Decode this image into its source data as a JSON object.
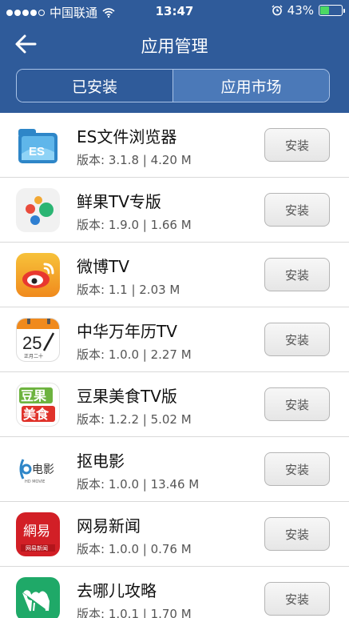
{
  "status_bar": {
    "carrier": "中国联通",
    "time": "13:47",
    "battery_percent": "43%",
    "battery_level": 0.43,
    "signal_filled": 4,
    "signal_total": 5
  },
  "nav": {
    "title": "应用管理"
  },
  "tabs": [
    {
      "label": "已安装",
      "selected": true
    },
    {
      "label": "应用市场",
      "selected": false
    }
  ],
  "colors": {
    "header_bg": "#2f5b9a",
    "tab_inactive_bg": "#4b79b8",
    "battery_fill": "#4cd964"
  },
  "apps": [
    {
      "name": "ES文件浏览器",
      "version_label": "版本: 3.1.8 | 4.20 M",
      "button_label": "安装",
      "icon": "es-file-explorer-icon"
    },
    {
      "name": "鲜果TV专版",
      "version_label": "版本: 1.9.0 | 1.66 M",
      "button_label": "安装",
      "icon": "xianguo-tv-icon"
    },
    {
      "name": "微博TV",
      "version_label": "版本: 1.1 | 2.03 M",
      "button_label": "安装",
      "icon": "weibo-icon"
    },
    {
      "name": "中华万年历TV",
      "version_label": "版本: 1.0.0 | 2.27 M",
      "button_label": "安装",
      "icon": "calendar-icon"
    },
    {
      "name": "豆果美食TV版",
      "version_label": "版本: 1.2.2 | 5.02 M",
      "button_label": "安装",
      "icon": "douguo-icon"
    },
    {
      "name": "抠电影",
      "version_label": "版本: 1.0.0 | 13.46 M",
      "button_label": "安装",
      "icon": "kou-movie-icon"
    },
    {
      "name": "网易新闻",
      "version_label": "版本: 1.0.0 | 0.76 M",
      "button_label": "安装",
      "icon": "netease-news-icon"
    },
    {
      "name": "去哪儿攻略",
      "version_label": "版本: 1.0.1 | 1.70 M",
      "button_label": "安装",
      "icon": "qunar-icon"
    }
  ],
  "icon_text": {
    "calendar_day": "25",
    "calendar_sub": "正月二十",
    "douguo_line1": "豆果",
    "douguo_line2": "美食",
    "kou_text": "电影",
    "kou_sub": "HD MOVIE",
    "netease_text": "網易",
    "netease_sub": "网易新闻"
  }
}
